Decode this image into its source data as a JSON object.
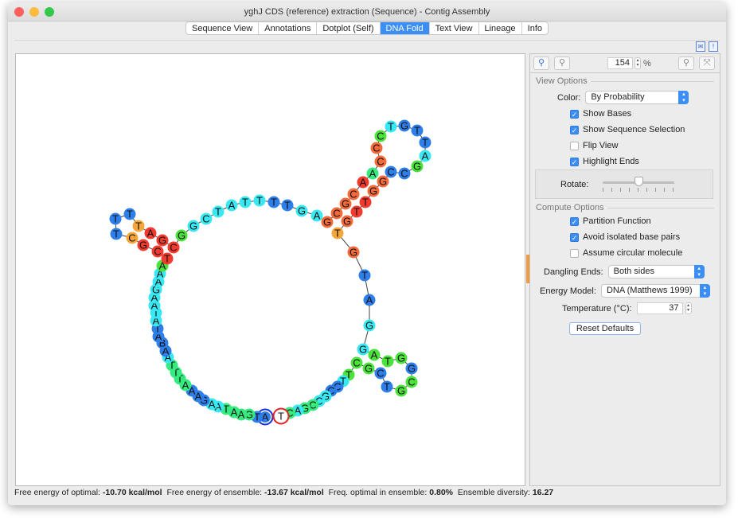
{
  "window": {
    "title": "yghJ CDS (reference) extraction (Sequence) - Contig Assembly"
  },
  "tabs": [
    {
      "label": "Sequence View",
      "active": false
    },
    {
      "label": "Annotations",
      "active": false
    },
    {
      "label": "Dotplot (Self)",
      "active": false
    },
    {
      "label": "DNA Fold",
      "active": true
    },
    {
      "label": "Text View",
      "active": false
    },
    {
      "label": "Lineage",
      "active": false
    },
    {
      "label": "Info",
      "active": false
    }
  ],
  "toolbar_icons": [
    "mail-alert-icon",
    "info-panel-icon"
  ],
  "panel": {
    "zoom_value": "154",
    "zoom_unit": "%",
    "view_options": {
      "heading": "View Options",
      "color_label": "Color:",
      "color_value": "By Probability",
      "checkboxes": [
        {
          "label": "Show Bases",
          "checked": true
        },
        {
          "label": "Show Sequence Selection",
          "checked": true
        },
        {
          "label": "Flip View",
          "checked": false
        },
        {
          "label": "Highlight Ends",
          "checked": true
        }
      ],
      "rotate_label": "Rotate:",
      "rotate_fraction": 0.5
    },
    "compute_options": {
      "heading": "Compute Options",
      "checkboxes": [
        {
          "label": "Partition Function",
          "checked": true
        },
        {
          "label": "Avoid isolated base pairs",
          "checked": true
        },
        {
          "label": "Assume circular molecule",
          "checked": false
        }
      ],
      "dangling_label": "Dangling Ends:",
      "dangling_value": "Both sides",
      "energy_label": "Energy Model:",
      "energy_value": "DNA (Matthews 1999)",
      "temp_label": "Temperature (°C):",
      "temp_value": "37",
      "reset_label": "Reset Defaults"
    }
  },
  "status": {
    "optimal_label": "Free energy of optimal:",
    "optimal_value": "-10.70 kcal/mol",
    "ensemble_label": "Free energy of ensemble:",
    "ensemble_value": "-13.67 kcal/mol",
    "freq_label": "Freq. optimal in ensemble:",
    "freq_value": "0.80%",
    "diversity_label": "Ensemble diversity:",
    "diversity_value": "16.27"
  },
  "fold": {
    "sequence": "ATGAATAAGAAATTTAABATATAAGAAATCGCTTTTAGCGGCTATTTTGAGCGCAACCCTGTTAGCCGGTTGTGTAGGATGGCGTCGCTTCCGCCGACTCCTG",
    "prob_classes": "BBSSSSCCBBBSSSSCBBBBCCCCCCCGRRRYBBBYRRRGCCCCCCBBCCOOOORSOOGCBBBCGBBOORROYOBBCCGGGBGGBBGGGCBBCCSSCSSS",
    "palette": {
      "R": "#f23a2e",
      "O": "#f46a3a",
      "Y": "#f6a63a",
      "G": "#4ce23c",
      "S": "#35ea7e",
      "C": "#38e8f2",
      "B": "#2f7fea"
    },
    "start_highlight_color": "#1530d8",
    "end_highlight_color": "#e82020"
  }
}
